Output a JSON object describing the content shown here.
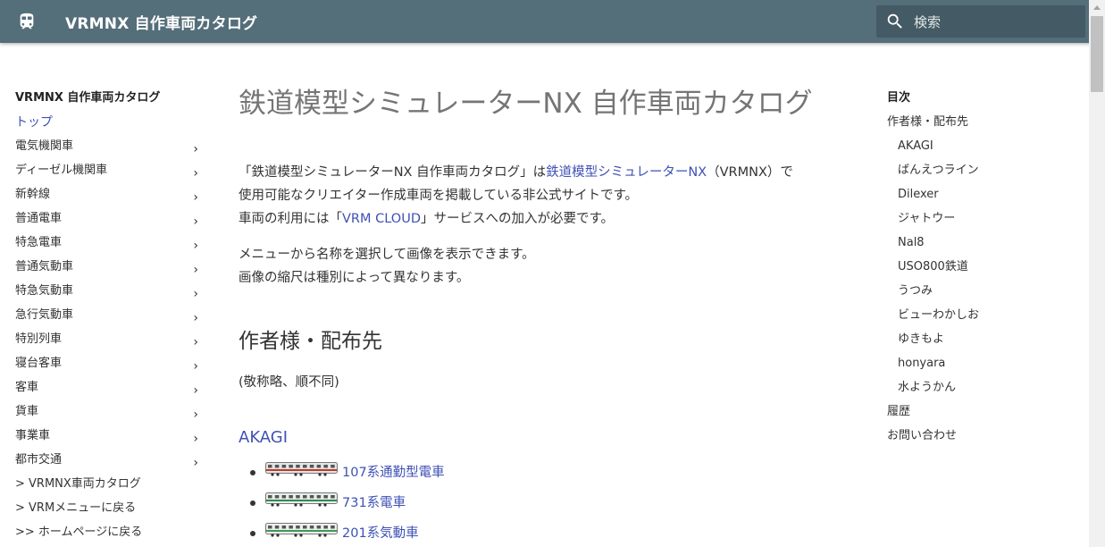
{
  "header": {
    "site_title": "VRMNX 自作車両カタログ",
    "search_placeholder": "検索",
    "logo_icon": "train-icon",
    "colors": {
      "bar": "#546e7a",
      "link": "#3f51b5"
    }
  },
  "nav": {
    "title": "VRMNX 自作車両カタログ",
    "items": [
      {
        "label": "トップ",
        "chevron": false,
        "active": true
      },
      {
        "label": "電気機関車",
        "chevron": true
      },
      {
        "label": "ディーゼル機関車",
        "chevron": true
      },
      {
        "label": "新幹線",
        "chevron": true
      },
      {
        "label": "普通電車",
        "chevron": true
      },
      {
        "label": "特急電車",
        "chevron": true
      },
      {
        "label": "普通気動車",
        "chevron": true
      },
      {
        "label": "特急気動車",
        "chevron": true
      },
      {
        "label": "急行気動車",
        "chevron": true
      },
      {
        "label": "特別列車",
        "chevron": true
      },
      {
        "label": "寝台客車",
        "chevron": true
      },
      {
        "label": "客車",
        "chevron": true
      },
      {
        "label": "貨車",
        "chevron": true
      },
      {
        "label": "事業車",
        "chevron": true
      },
      {
        "label": "都市交通",
        "chevron": true
      },
      {
        "label": "> VRMNX車両カタログ",
        "chevron": false
      },
      {
        "label": "> VRMメニューに戻る",
        "chevron": false
      },
      {
        "label": ">> ホームページに戻る",
        "chevron": false
      }
    ]
  },
  "main": {
    "title": "鉄道模型シミュレーターNX 自作車両カタログ",
    "p1_a": "「鉄道模型シミュレーターNX 自作車両カタログ」は",
    "p1_link": "鉄道模型シミュレーターNX",
    "p1_b": "（VRMNX）で",
    "p1_c": "使用可能なクリエイター作成車両を掲載している非公式サイトです。",
    "p1_d": "車両の利用には「",
    "p1_link2": "VRM CLOUD",
    "p1_e": "」サービスへの加入が必要です。",
    "p2_a": "メニューから名称を選択して画像を表示できます。",
    "p2_b": "画像の縮尺は種別によって異なります。",
    "h2": "作者様・配布先",
    "note": "(敬称略、順不同)",
    "h3": "AKAGI",
    "trains": [
      {
        "label": "107系通勤型電車"
      },
      {
        "label": "731系電車"
      },
      {
        "label": "201系気動車"
      }
    ]
  },
  "toc": {
    "title": "目次",
    "items": [
      {
        "label": "作者様・配布先",
        "sub": false
      },
      {
        "label": "AKAGI",
        "sub": true
      },
      {
        "label": "ばんえつライン",
        "sub": true
      },
      {
        "label": "Dilexer",
        "sub": true
      },
      {
        "label": "ジャトウー",
        "sub": true
      },
      {
        "label": "Nal8",
        "sub": true
      },
      {
        "label": "USO800鉄道",
        "sub": true
      },
      {
        "label": "うつみ",
        "sub": true
      },
      {
        "label": "ビューわかしお",
        "sub": true
      },
      {
        "label": "ゆきもよ",
        "sub": true
      },
      {
        "label": "honyara",
        "sub": true
      },
      {
        "label": "水ようかん",
        "sub": true
      },
      {
        "label": "履歴",
        "sub": false
      },
      {
        "label": "お問い合わせ",
        "sub": false
      }
    ]
  }
}
